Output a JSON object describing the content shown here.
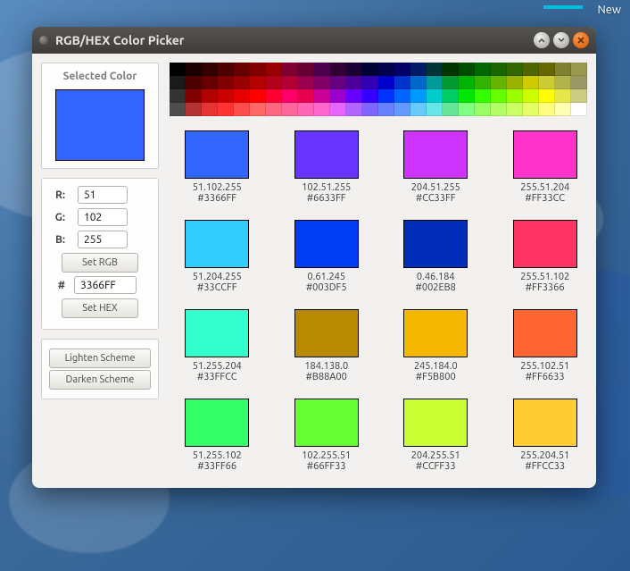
{
  "topbar": {
    "new_label": "New"
  },
  "window": {
    "title": "RGB/HEX Color Picker"
  },
  "sidebar": {
    "selected_label": "Selected Color",
    "selected_hex": "#3366FF",
    "labels": {
      "r": "R:",
      "g": "G:",
      "b": "B:",
      "hash": "#"
    },
    "r_value": "51",
    "g_value": "102",
    "b_value": "255",
    "hex_value": "3366FF",
    "buttons": {
      "set_rgb": "Set RGB",
      "set_hex": "Set HEX",
      "lighten": "Lighten Scheme",
      "darken": "Darken Scheme"
    }
  },
  "palette": {
    "rows": 4,
    "cols": 26,
    "colors": [
      [
        "#000000",
        "#1A0000",
        "#330000",
        "#4D0000",
        "#660000",
        "#800000",
        "#990000",
        "#800033",
        "#660033",
        "#4D004D",
        "#330033",
        "#1A0033",
        "#000033",
        "#00004D",
        "#000066",
        "#001A66",
        "#003333",
        "#003300",
        "#004D00",
        "#006600",
        "#1A6600",
        "#336600",
        "#4D6600",
        "#666600",
        "#808033",
        "#99994D"
      ],
      [
        "#1A1A1A",
        "#4D0000",
        "#660000",
        "#800000",
        "#990000",
        "#B30000",
        "#B3001A",
        "#B30033",
        "#99004D",
        "#800066",
        "#660080",
        "#4D0099",
        "#3300B3",
        "#0000CC",
        "#0033CC",
        "#0066CC",
        "#009999",
        "#009933",
        "#00B300",
        "#33B300",
        "#66B300",
        "#99B300",
        "#CCCC00",
        "#CCCC33",
        "#B3B34D",
        "#999966"
      ],
      [
        "#333333",
        "#800000",
        "#B30000",
        "#CC0000",
        "#E60000",
        "#FF0000",
        "#FF0033",
        "#FF0066",
        "#E6004D",
        "#CC0099",
        "#9900CC",
        "#6600FF",
        "#3300FF",
        "#0033FF",
        "#0066FF",
        "#0099FF",
        "#00CCCC",
        "#00CC66",
        "#00E600",
        "#33FF00",
        "#66FF00",
        "#99FF00",
        "#CCFF00",
        "#FFFF00",
        "#E6E64D",
        "#CCCC80"
      ],
      [
        "#4D4D4D",
        "#B33333",
        "#E63333",
        "#FF3333",
        "#FF4D4D",
        "#FF6666",
        "#FF6680",
        "#FF6699",
        "#FF66B3",
        "#FF66CC",
        "#E666FF",
        "#B366FF",
        "#8066FF",
        "#6680FF",
        "#6699FF",
        "#66CCFF",
        "#66E6E6",
        "#66E699",
        "#80FF80",
        "#99FF66",
        "#B3FF66",
        "#CCFF66",
        "#E6FF66",
        "#FFFF80",
        "#FFFFB3",
        "#FFFFFF"
      ]
    ]
  },
  "scheme": [
    {
      "hex": "#3366FF",
      "rgb": "51.102.255",
      "hex_label": "#3366FF"
    },
    {
      "hex": "#6633FF",
      "rgb": "102.51.255",
      "hex_label": "#6633FF"
    },
    {
      "hex": "#CC33FF",
      "rgb": "204.51.255",
      "hex_label": "#CC33FF"
    },
    {
      "hex": "#FF33CC",
      "rgb": "255.51.204",
      "hex_label": "#FF33CC"
    },
    {
      "hex": "#33CCFF",
      "rgb": "51.204.255",
      "hex_label": "#33CCFF"
    },
    {
      "hex": "#003DF5",
      "rgb": "0.61.245",
      "hex_label": "#003DF5"
    },
    {
      "hex": "#002EB8",
      "rgb": "0.46.184",
      "hex_label": "#002EB8"
    },
    {
      "hex": "#FF3366",
      "rgb": "255.51.102",
      "hex_label": "#FF3366"
    },
    {
      "hex": "#33FFCC",
      "rgb": "51.255.204",
      "hex_label": "#33FFCC"
    },
    {
      "hex": "#B88A00",
      "rgb": "184.138.0",
      "hex_label": "#B88A00"
    },
    {
      "hex": "#F5B800",
      "rgb": "245.184.0",
      "hex_label": "#F5B800"
    },
    {
      "hex": "#FF6633",
      "rgb": "255.102.51",
      "hex_label": "#FF6633"
    },
    {
      "hex": "#33FF66",
      "rgb": "51.255.102",
      "hex_label": "#33FF66"
    },
    {
      "hex": "#66FF33",
      "rgb": "102.255.51",
      "hex_label": "#66FF33"
    },
    {
      "hex": "#CCFF33",
      "rgb": "204.255.51",
      "hex_label": "#CCFF33"
    },
    {
      "hex": "#FFCC33",
      "rgb": "255.204.51",
      "hex_label": "#FFCC33"
    }
  ]
}
